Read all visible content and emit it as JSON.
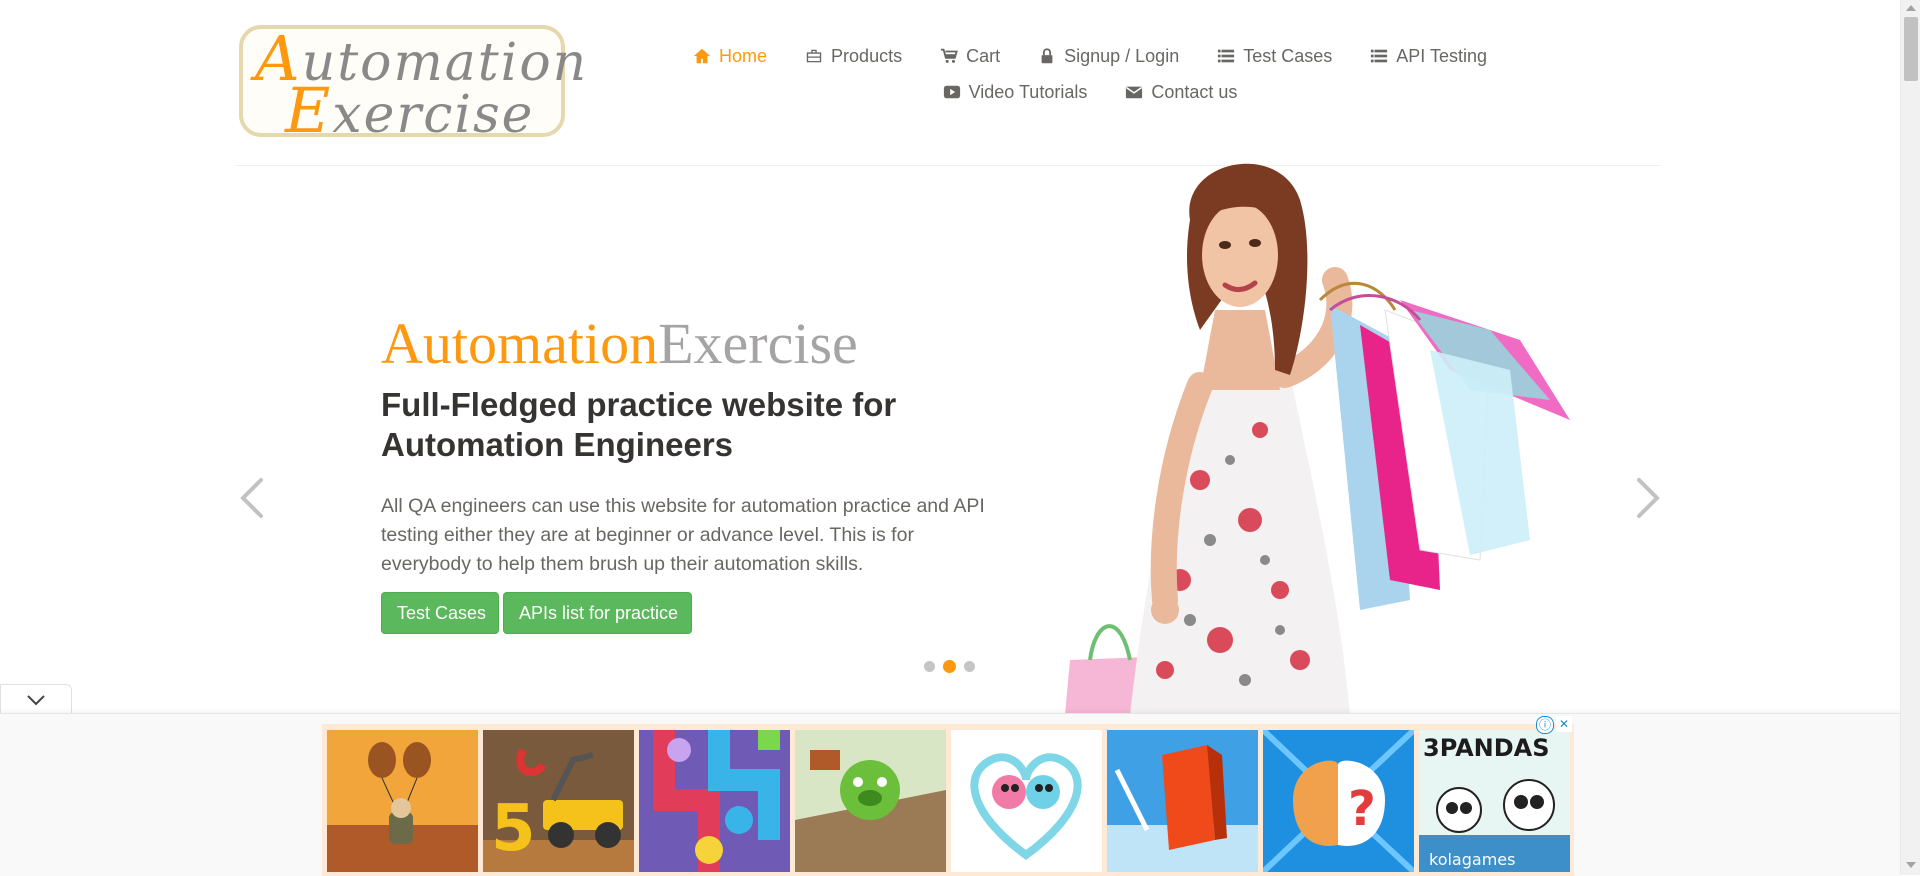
{
  "logo": {
    "line1_cap": "A",
    "line1_rest": "utomation",
    "line2_cap": "E",
    "line2_rest": "xercise"
  },
  "nav": {
    "row1": [
      {
        "label": "Home",
        "icon": "home-icon",
        "active": true
      },
      {
        "label": "Products",
        "icon": "briefcase-icon"
      },
      {
        "label": "Cart",
        "icon": "cart-icon"
      },
      {
        "label": "Signup / Login",
        "icon": "lock-icon"
      },
      {
        "label": "Test Cases",
        "icon": "list-icon"
      },
      {
        "label": "API Testing",
        "icon": "list-icon"
      }
    ],
    "row2": [
      {
        "label": "Video Tutorials",
        "icon": "youtube-play-icon"
      },
      {
        "label": "Contact us",
        "icon": "envelope-icon"
      }
    ]
  },
  "slider": {
    "brand_part1": "Automation",
    "brand_part2": "Exercise",
    "headline": "Full-Fledged practice website for Automation Engineers",
    "description": "All QA engineers can use this website for automation practice and API testing either they are at beginner or advance level. This is for everybody to help them brush up their automation skills.",
    "buttons": {
      "test_cases": "Test Cases",
      "apis_list": "APIs list for practice"
    },
    "active_slide": 2,
    "slide_count": 3
  },
  "ad_bar": {
    "tiles": [
      "balloon-game-icon",
      "number-5-truck-icon",
      "pipe-puzzle-icon",
      "angry-pig-icon",
      "love-balls-icon",
      "red-block-icon",
      "brain-question-icon",
      "3-pandas-icon"
    ],
    "tile8_text": "3PANDAS",
    "tile8_footer": "kolagames",
    "info_glyph": "ⓘ",
    "close_glyph": "✕"
  },
  "colors": {
    "accent": "#fe980f",
    "button_green": "#5cb85c",
    "text": "#696763",
    "heading": "#363432"
  }
}
